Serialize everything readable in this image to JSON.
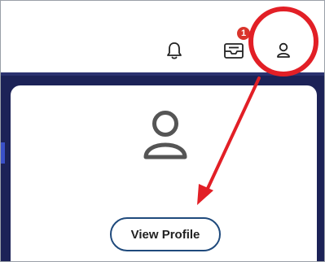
{
  "header": {
    "notification_badge": "1",
    "icons": [
      "bell-icon",
      "inbox-icon",
      "user-icon"
    ]
  },
  "profile_menu": {
    "view_profile_label": "View Profile"
  },
  "colors": {
    "navy": "#1c2257",
    "highlight_red": "#e21f26",
    "badge_red": "#d9342b",
    "button_border": "#1f4a7c"
  }
}
